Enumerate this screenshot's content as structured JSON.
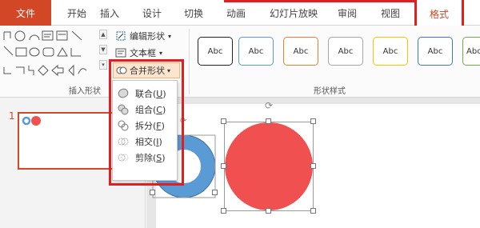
{
  "tabs": [
    "文件",
    "开始",
    "插入",
    "设计",
    "切换",
    "动画",
    "幻灯片放映",
    "审阅",
    "视图",
    "格式"
  ],
  "ribbon": {
    "edit_shape": "编辑形状",
    "text_box": "文本框",
    "merge_shapes": "合并形状",
    "insert_shape_group": "插入形状",
    "shape_styles_group": "形状样式",
    "style_preview_label": "Abc",
    "style_colors": [
      "#222222",
      "#5b9bd5",
      "#ed7d31",
      "#a5a5a5",
      "#ffc000",
      "#4472c4",
      "#70ad47"
    ]
  },
  "merge_menu": {
    "items": [
      {
        "label": "联合",
        "key": "U"
      },
      {
        "label": "组合",
        "key": "C"
      },
      {
        "label": "拆分",
        "key": "F"
      },
      {
        "label": "相交",
        "key": "I"
      },
      {
        "label": "剪除",
        "key": "S"
      }
    ]
  },
  "slide_pane": {
    "slide_number": "1"
  },
  "colors": {
    "accent": "#d24726",
    "highlight": "#e02020",
    "red_circle": "#f15050",
    "blue_ring": "#5b9bd5"
  }
}
